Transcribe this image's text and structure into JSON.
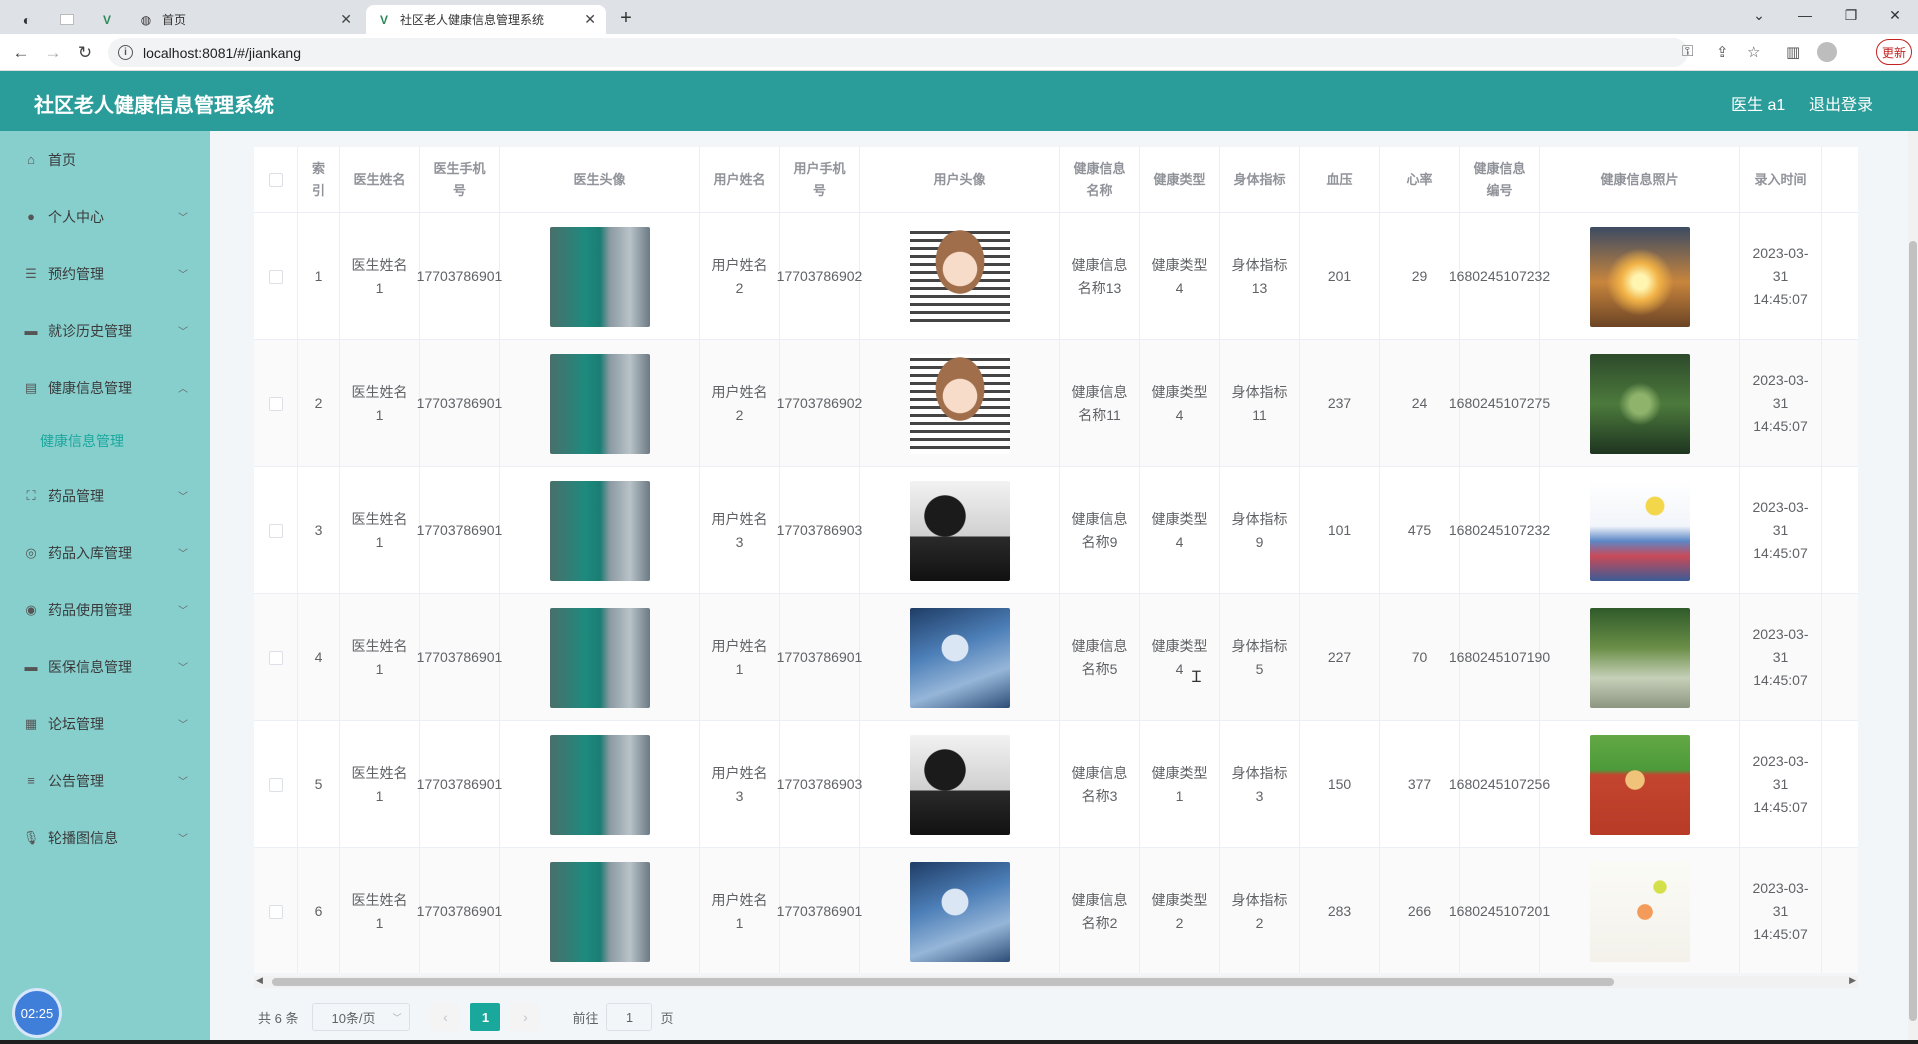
{
  "browser": {
    "tabs": [
      {
        "label": "",
        "icon": "browser-icon"
      },
      {
        "label": "",
        "icon": "blank-page-icon"
      },
      {
        "label": "",
        "icon": "vue-icon"
      },
      {
        "label": "首页",
        "icon": "globe-icon"
      },
      {
        "label": "社区老人健康信息管理系统",
        "icon": "vue-icon",
        "active": true
      }
    ],
    "url": "localhost:8081/#/jiankang",
    "update_label": "更新"
  },
  "header": {
    "title": "社区老人健康信息管理系统",
    "user": "医生 a1",
    "logout": "退出登录"
  },
  "sidebar": {
    "items": [
      {
        "label": "首页",
        "icon": "home-icon"
      },
      {
        "label": "个人中心",
        "icon": "user-icon"
      },
      {
        "label": "预约管理",
        "icon": "list-icon"
      },
      {
        "label": "就诊历史管理",
        "icon": "monitor-icon"
      },
      {
        "label": "健康信息管理",
        "icon": "document-icon",
        "expanded": true
      },
      {
        "label": "药品管理",
        "icon": "crop-icon"
      },
      {
        "label": "药品入库管理",
        "icon": "compass-icon"
      },
      {
        "label": "药品使用管理",
        "icon": "circle-icon"
      },
      {
        "label": "医保信息管理",
        "icon": "monitor-icon"
      },
      {
        "label": "论坛管理",
        "icon": "grid-icon"
      },
      {
        "label": "公告管理",
        "icon": "sliders-icon"
      },
      {
        "label": "轮播图信息",
        "icon": "microphone-icon"
      }
    ],
    "sub_item": "健康信息管理",
    "clock": "02:25"
  },
  "table": {
    "headers": [
      "索引",
      "医生姓名",
      "医生手机号",
      "医生头像",
      "用户姓名",
      "用户手机号",
      "用户头像",
      "健康信息名称",
      "健康类型",
      "身体指标",
      "血压",
      "心率",
      "健康信息编号",
      "健康信息照片",
      "录入时间"
    ],
    "rows": [
      {
        "index": "1",
        "doctor_name": "医生姓名1",
        "doctor_phone": "17703786901",
        "user_name": "用户姓名2",
        "user_phone": "17703786902",
        "user_avatar": "girl",
        "info_name": "健康信息名称13",
        "type": "健康类型4",
        "indicator": "身体指标13",
        "bp": "201",
        "hr": "29",
        "code": "1680245107232",
        "photo": "sunset-run",
        "time": "2023-03-31 14:45:07"
      },
      {
        "index": "2",
        "doctor_name": "医生姓名1",
        "doctor_phone": "17703786901",
        "user_name": "用户姓名2",
        "user_phone": "17703786902",
        "user_avatar": "girl",
        "info_name": "健康信息名称11",
        "type": "健康类型4",
        "indicator": "身体指标11",
        "bp": "237",
        "hr": "24",
        "code": "1680245107275",
        "photo": "forest-run",
        "time": "2023-03-31 14:45:07"
      },
      {
        "index": "3",
        "doctor_name": "医生姓名1",
        "doctor_phone": "17703786901",
        "user_name": "用户姓名3",
        "user_phone": "17703786903",
        "user_avatar": "man-dark",
        "info_name": "健康信息名称9",
        "type": "健康类型4",
        "indicator": "身体指标9",
        "bp": "101",
        "hr": "475",
        "code": "1680245107232",
        "photo": "city-sport",
        "time": "2023-03-31 14:45:07"
      },
      {
        "index": "4",
        "doctor_name": "医生姓名1",
        "doctor_phone": "17703786901",
        "user_name": "用户姓名1",
        "user_phone": "17703786901",
        "user_avatar": "boy-blue",
        "info_name": "健康信息名称5",
        "type": "健康类型4",
        "indicator": "身体指标5",
        "bp": "227",
        "hr": "70",
        "code": "1680245107190",
        "photo": "park-exercise",
        "time": "2023-03-31 14:45:07"
      },
      {
        "index": "5",
        "doctor_name": "医生姓名1",
        "doctor_phone": "17703786901",
        "user_name": "用户姓名3",
        "user_phone": "17703786903",
        "user_avatar": "man-dark",
        "info_name": "健康信息名称3",
        "type": "健康类型1",
        "indicator": "身体指标3",
        "bp": "150",
        "hr": "377",
        "code": "1680245107256",
        "photo": "track-run",
        "time": "2023-03-31 14:45:07"
      },
      {
        "index": "6",
        "doctor_name": "医生姓名1",
        "doctor_phone": "17703786901",
        "user_name": "用户姓名1",
        "user_phone": "17703786901",
        "user_avatar": "boy-blue",
        "info_name": "健康信息名称2",
        "type": "健康类型2",
        "indicator": "身体指标2",
        "bp": "283",
        "hr": "266",
        "code": "1680245107201",
        "photo": "tennis",
        "time": "2023-03-31 14:45:07"
      }
    ]
  },
  "pagination": {
    "total": "共 6 条",
    "page_size": "10条/页",
    "current_page": "1",
    "goto_label": "前往",
    "goto_value": "1",
    "page_unit": "页"
  }
}
